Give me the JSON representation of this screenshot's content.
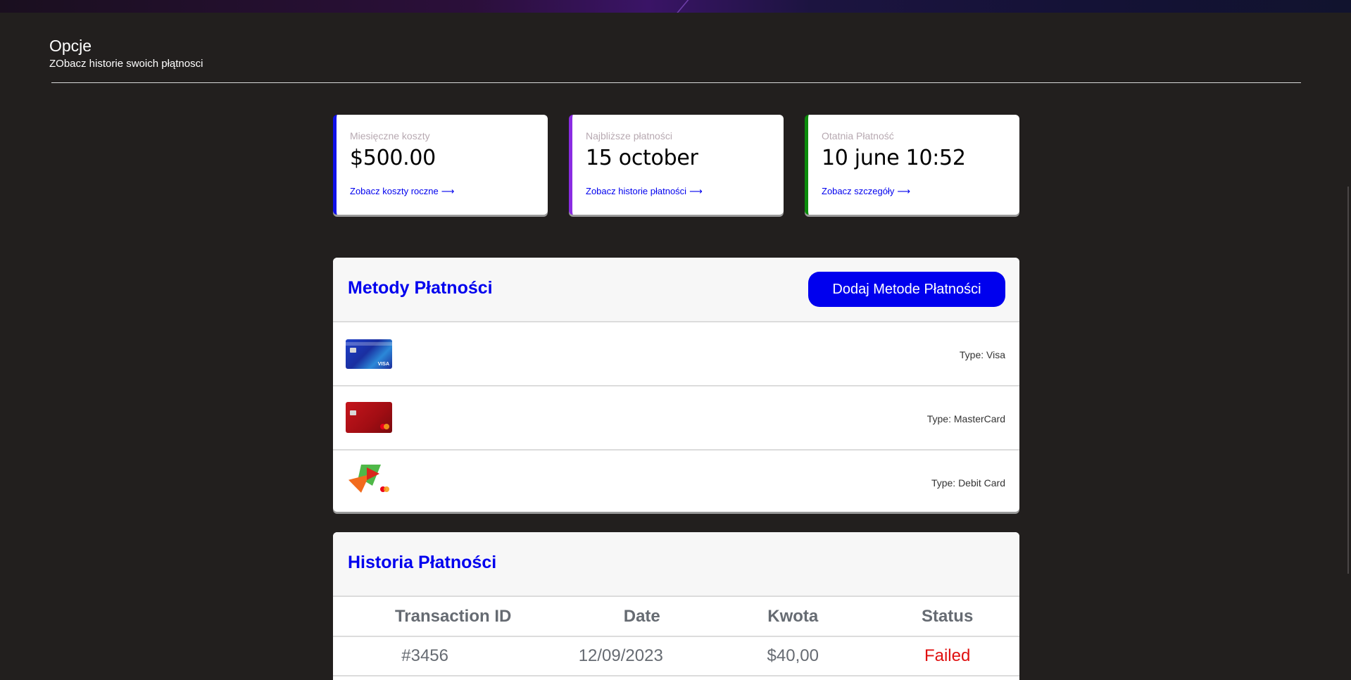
{
  "header": {
    "title": "Opcje",
    "subtitle": "ZObacz historie swoich płątnosci"
  },
  "stats": [
    {
      "label": "Miesięczne koszty",
      "value": "$500.00",
      "link": "Zobacz koszty roczne",
      "accent": "#1010e8"
    },
    {
      "label": "Najbliższe płatności",
      "value": "15 october",
      "link": "Zobacz historie płatności",
      "accent": "#8a2be2"
    },
    {
      "label": "Otatnia Płatność",
      "value": "10 june 10:52",
      "link": "Zobacz szczegóły",
      "accent": "#0a8a0a"
    }
  ],
  "methods": {
    "title": "Metody Płatności",
    "add_button": "Dodaj Metode Płatności",
    "items": [
      {
        "type": "Type: Visa",
        "icon": "visa-card-icon"
      },
      {
        "type": "Type: MasterCard",
        "icon": "mastercard-card-icon"
      },
      {
        "type": "Type: Debit Card",
        "icon": "debit-card-icon"
      }
    ]
  },
  "history": {
    "title": "Historia Płatności",
    "columns": [
      "Transaction ID",
      "Date",
      "Kwota",
      "Status"
    ],
    "rows": [
      {
        "id": "#3456",
        "date": "12/09/2023",
        "amount": "$40,00",
        "status": "Failed"
      }
    ]
  },
  "colors": {
    "accent": "#0000ee",
    "background": "#221f1e",
    "failed": "#e01010"
  }
}
